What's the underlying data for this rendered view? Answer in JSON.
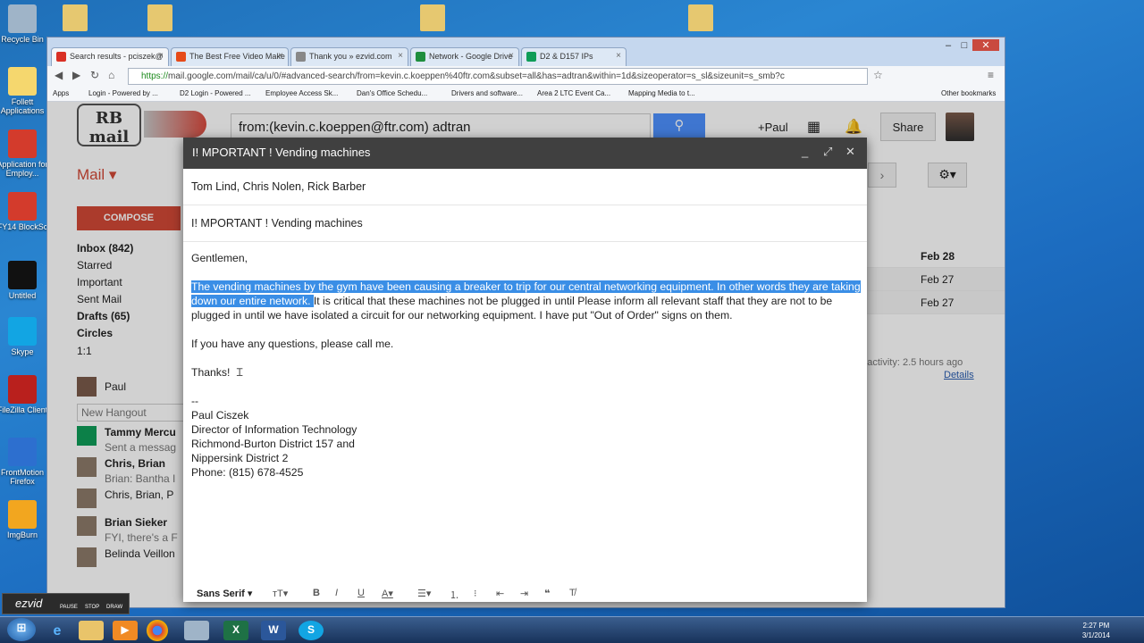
{
  "desktop_icons": [
    {
      "label": "Recycle Bin",
      "color": "#9fb4c8"
    },
    {
      "label": "Follett Applications",
      "color": "#f5d76e"
    },
    {
      "label": "Application for Employ...",
      "color": "#d33b2c"
    },
    {
      "label": "FY14 BlockSc",
      "color": "#d33b2c"
    },
    {
      "label": "Untitled",
      "color": "#111111"
    },
    {
      "label": "Skype",
      "color": "#12a5e3"
    },
    {
      "label": "FileZilla Client",
      "color": "#b9201d"
    },
    {
      "label": "FrontMotion Firefox",
      "color": "#2d6fcf"
    },
    {
      "label": "ImgBurn",
      "color": "#f2a61f"
    }
  ],
  "tabs": [
    {
      "label": "Search results - pciszek@",
      "active": true,
      "color": "#d93025"
    },
    {
      "label": "The Best Free Video Make",
      "active": false,
      "color": "#e64a19"
    },
    {
      "label": "Thank you » ezvid.com",
      "active": false,
      "color": "#888888"
    },
    {
      "label": "Network - Google Drive",
      "active": false,
      "color": "#1e8e3e"
    },
    {
      "label": "D2 & D157 IPs",
      "active": false,
      "color": "#0f9d58"
    }
  ],
  "window_controls": [
    "–",
    "□",
    "✕"
  ],
  "url": {
    "secure": "https://",
    "text": "mail.google.com/mail/ca/u/0/#advanced-search/from=kevin.c.koeppen%40ftr.com&subset=all&has=adtran&within=1d&sizeoperator=s_sl&sizeunit=s_smb?c"
  },
  "bookmarks": [
    "Apps",
    "Login - Powered by ...",
    "D2 Login - Powered ...",
    "Employee Access Sk...",
    "Dan's Office Schedu...",
    "Drivers and software...",
    "Area 2 LTC Event Ca...",
    "Mapping Media to t..."
  ],
  "other_bookmarks": "Other bookmarks",
  "gmail": {
    "logo": "RB mail",
    "search_value": "from:(kevin.c.koeppen@ftr.com) adtran",
    "user": "+Paul",
    "share": "Share",
    "mail_label": "Mail ▾",
    "compose": "COMPOSE",
    "labels": [
      "Inbox (842)",
      "Starred",
      "Important",
      "Sent Mail",
      "Drafts (65)",
      "Circles",
      "1:1"
    ],
    "chat_user": "Paul",
    "new_hangout": "New Hangout",
    "contacts": [
      {
        "name": "Tammy Mercu",
        "sub": "Sent a messag"
      },
      {
        "name": "Chris, Brian",
        "sub": "Brian: Bantha I"
      },
      {
        "name": "Chris, Brian, P",
        "sub": ""
      },
      {
        "name": "Brian Sieker",
        "sub": "FYI, there's a F"
      },
      {
        "name": "Belinda Veillon",
        "sub": ""
      }
    ],
    "dates": [
      "Feb 28",
      "Feb 27",
      "Feb 27"
    ],
    "activity": "nt activity: 2.5 hours ago",
    "details": "Details"
  },
  "compose_window": {
    "title": "I! MPORTANT ! Vending machines",
    "controls": [
      "_",
      "⤢",
      "✕"
    ],
    "recipients": "Tom Lind, Chris Nolen, Rick Barber",
    "subject": "I! MPORTANT ! Vending machines",
    "greeting": "Gentlemen,",
    "highlighted": "The vending machines by the gym have been causing a breaker to trip for our central networking equipment. In other words they are taking down our entire network. ",
    "body_rest": "It is critical that these machines not be plugged in until Please inform all relevant staff that they are not to be plugged in until we have isolated a circuit for our networking equipment. I have put \"Out of Order\" signs on them.",
    "questions": "If you have any questions, please call me.",
    "thanks": "Thanks!",
    "sig_sep": "--",
    "sig": [
      "Paul Ciszek",
      "Director of Information Technology",
      "Richmond-Burton District 157 and",
      "Nippersink District 2",
      "Phone: (815) 678-4525"
    ],
    "font": "Sans Serif ▾"
  },
  "taskbar": {
    "time": "2:27 PM",
    "date": "3/1/2014"
  },
  "ezvid": {
    "brand": "ezvid",
    "buttons": [
      "PAUSE",
      "STOP",
      "DRAW"
    ]
  }
}
